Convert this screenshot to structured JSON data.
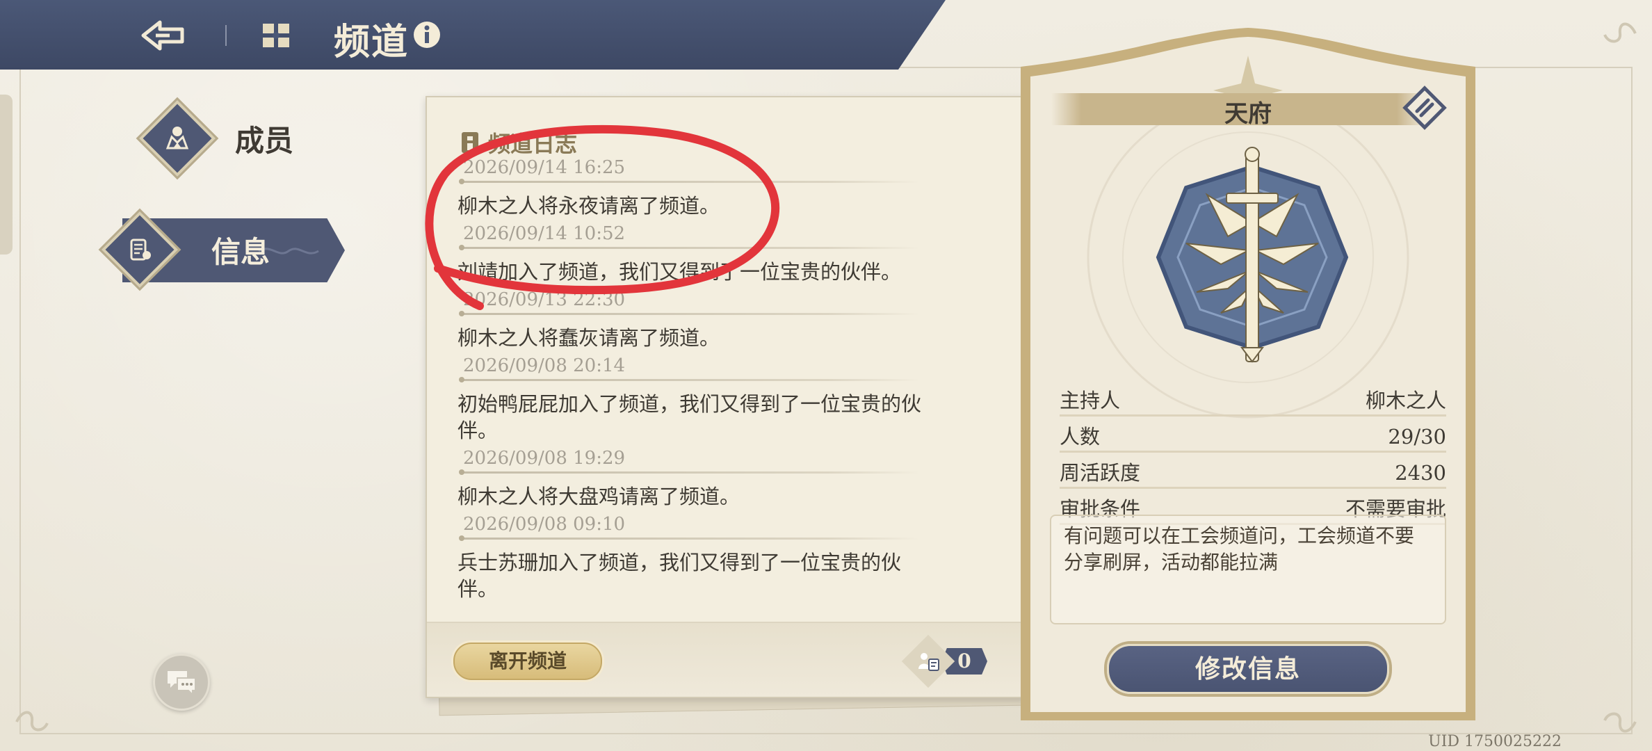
{
  "header": {
    "title": "频道"
  },
  "nav": {
    "members_label": "成员",
    "info_label": "信息"
  },
  "log": {
    "title": "频道日志",
    "entries": [
      {
        "time": "2026/09/14 16:25",
        "text": "柳木之人将永夜请离了频道。"
      },
      {
        "time": "2026/09/14 10:52",
        "text": "刘靖加入了频道，我们又得到了一位宝贵的伙伴。"
      },
      {
        "time": "2026/09/13 22:30",
        "text": "柳木之人将蠢灰请离了频道。"
      },
      {
        "time": "2026/09/08 20:14",
        "text": "初始鸭屁屁加入了频道，我们又得到了一位宝贵的伙伴。"
      },
      {
        "time": "2026/09/08 19:29",
        "text": "柳木之人将大盘鸡请离了频道。"
      },
      {
        "time": "2026/09/08 09:10",
        "text": "兵士苏珊加入了频道，我们又得到了一位宝贵的伙伴。"
      }
    ],
    "leave_button": "离开频道",
    "requests_count": "0"
  },
  "guild": {
    "name": "天府",
    "stats": [
      {
        "label": "主持人",
        "value": "柳木之人"
      },
      {
        "label": "人数",
        "value": "29/30"
      },
      {
        "label": "周活跃度",
        "value": "2430"
      },
      {
        "label": "审批条件",
        "value": "不需要审批"
      }
    ],
    "notice": "有问题可以在工会频道问，工会频道不要分享刷屏，活动都能拉满",
    "edit_button": "修改信息"
  },
  "uid": "UID 1750025222",
  "colors": {
    "banner": "#4b5877",
    "accent_gold": "#d7bc7a",
    "annotation_red": "#e2353b"
  }
}
